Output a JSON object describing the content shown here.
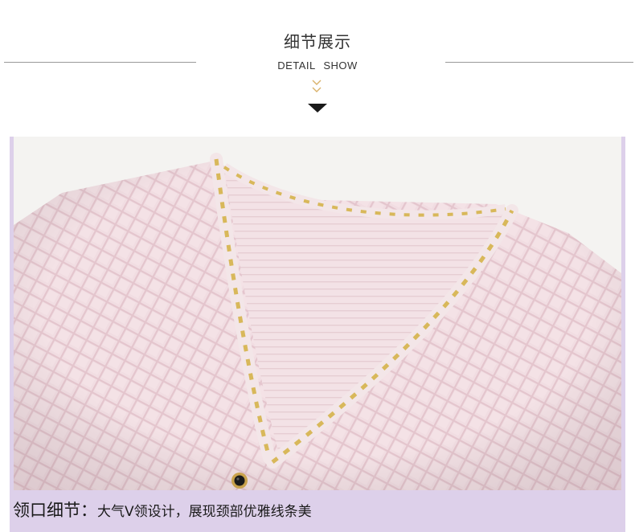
{
  "header": {
    "title_cn": "细节展示",
    "title_en": "DETAIL  SHOW",
    "chevron_icon": "double-chevron-down-icon",
    "arrow_icon": "triangle-down-icon"
  },
  "colors": {
    "panel_background": "#ddd0ea",
    "fabric_pink": "#f2dde2",
    "gold_trim": "#d8b85a",
    "chevron_gold": "#d9b26a",
    "divider_gray": "#9a9a9a"
  },
  "caption": {
    "label": "领口细节：",
    "text": "大气V领设计，展现颈部优雅线条美"
  }
}
